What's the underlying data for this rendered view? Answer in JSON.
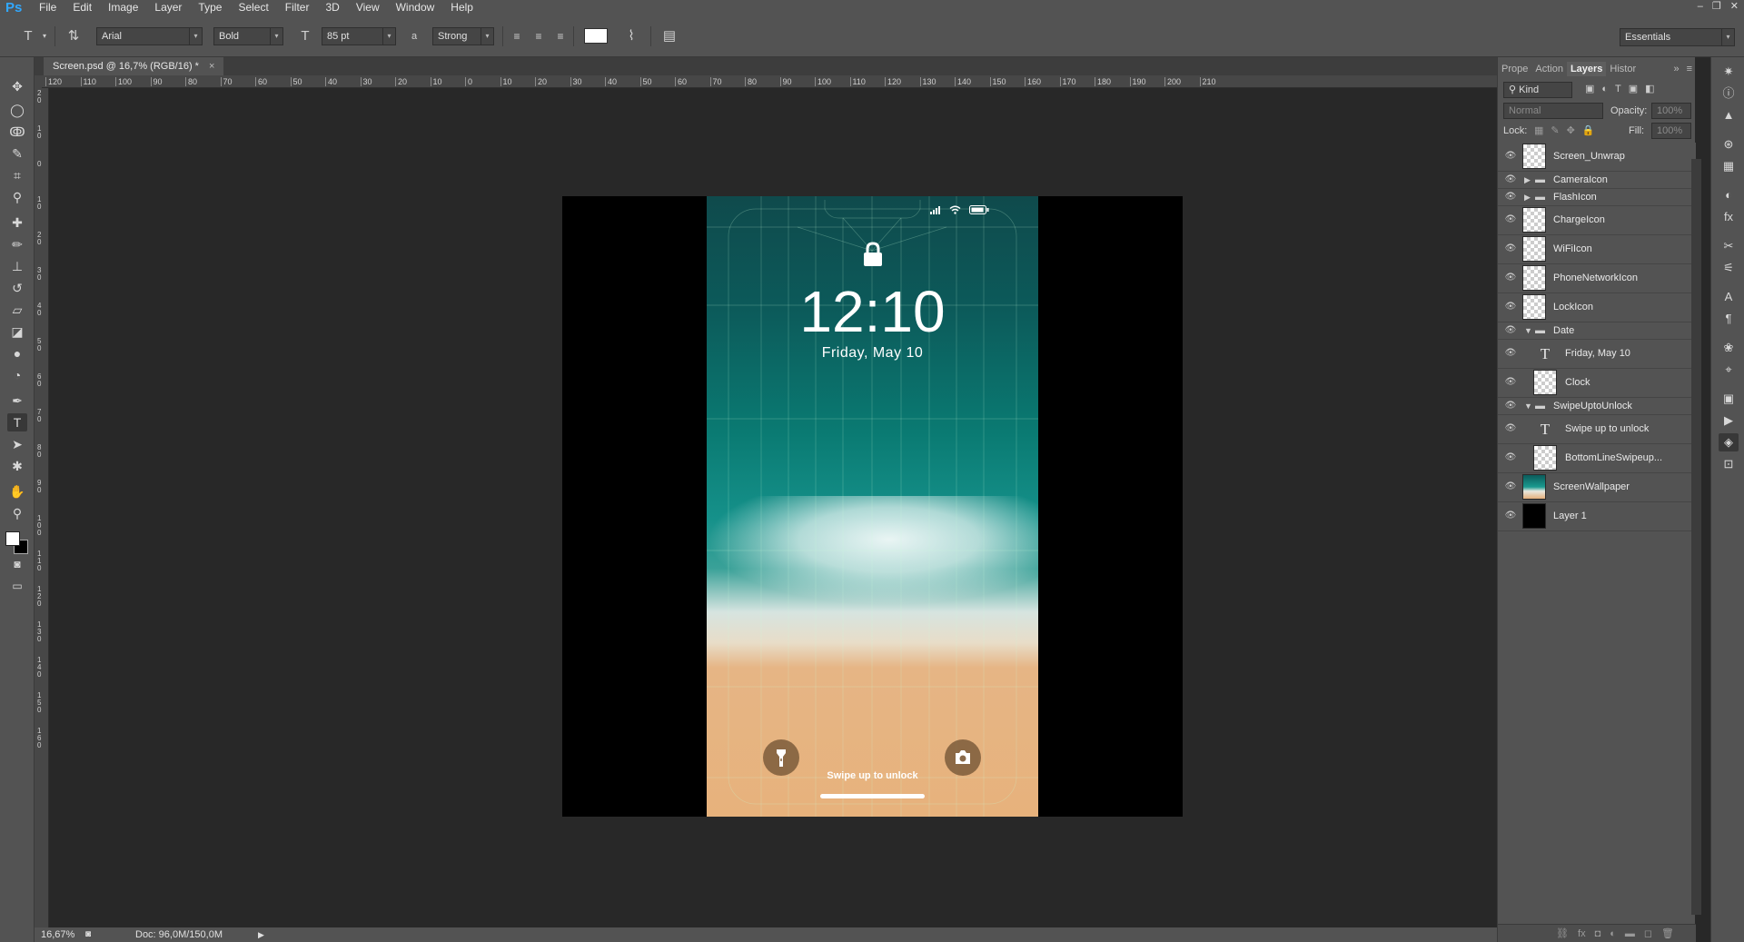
{
  "app": {
    "logo": "Ps"
  },
  "menu": [
    "File",
    "Edit",
    "Image",
    "Layer",
    "Type",
    "Select",
    "Filter",
    "3D",
    "View",
    "Window",
    "Help"
  ],
  "window_controls": [
    "–",
    "❐",
    "✕"
  ],
  "options_bar": {
    "font_family": "Arial",
    "font_style": "Bold",
    "font_size": "85 pt",
    "antialias": "Strong",
    "workspace": "Essentials",
    "aa_icon_text": "a"
  },
  "document": {
    "tab_title": "Screen.psd @ 16,7% (RGB/16) *",
    "tab_close": "×"
  },
  "rulers": {
    "h_labels": [
      "120",
      "110",
      "100",
      "90",
      "80",
      "70",
      "60",
      "50",
      "40",
      "30",
      "20",
      "10",
      "0",
      "10",
      "20",
      "30",
      "40",
      "50",
      "60",
      "70",
      "80",
      "90",
      "100",
      "110",
      "120",
      "130",
      "140",
      "150",
      "160",
      "170",
      "180",
      "190",
      "200",
      "210"
    ],
    "v_labels": [
      "2\n0",
      "1\n0",
      "0",
      "1\n0",
      "2\n0",
      "3\n0",
      "4\n0",
      "5\n0",
      "6\n0",
      "7\n0",
      "8\n0",
      "9\n0",
      "1\n0\n0",
      "1\n1\n0",
      "1\n2\n0",
      "1\n3\n0",
      "1\n4\n0",
      "1\n5\n0",
      "1\n6\n0"
    ]
  },
  "phone_screen": {
    "clock": "12:10",
    "date": "Friday, May 10",
    "swipe_text": "Swipe up to unlock"
  },
  "status_bar": {
    "zoom": "16,67%",
    "doc_info": "Doc: 96,0M/150,0M"
  },
  "panel": {
    "tabs": [
      "Prope",
      "Action",
      "Layers",
      "Histor"
    ],
    "active_tab": "Layers",
    "filter_kind": "Kind",
    "blend_mode": "Normal",
    "opacity_label": "Opacity:",
    "opacity_value": "100%",
    "lock_label": "Lock:",
    "fill_label": "Fill:",
    "fill_value": "100%",
    "layers": [
      {
        "name": "Screen_Unwrap",
        "kind": "pixel"
      },
      {
        "name": "CameraIcon",
        "kind": "group-collapsed"
      },
      {
        "name": "FlashIcon",
        "kind": "group-collapsed"
      },
      {
        "name": "ChargeIcon",
        "kind": "smart"
      },
      {
        "name": "WiFiIcon",
        "kind": "smart"
      },
      {
        "name": "PhoneNetworkIcon",
        "kind": "smart"
      },
      {
        "name": "LockIcon",
        "kind": "smart"
      },
      {
        "name": "Date",
        "kind": "group-open"
      },
      {
        "name": "Friday, May 10",
        "kind": "text"
      },
      {
        "name": "Clock",
        "kind": "pixel"
      },
      {
        "name": "SwipeUptoUnlock",
        "kind": "group-open"
      },
      {
        "name": "Swipe up to unlock",
        "kind": "text"
      },
      {
        "name": "BottomLineSwipeup...",
        "kind": "pixel"
      },
      {
        "name": "ScreenWallpaper",
        "kind": "wallpaper"
      },
      {
        "name": "Layer 1",
        "kind": "black"
      }
    ],
    "bottom_icons": [
      "link-icon",
      "fx-icon",
      "mask-icon",
      "adjustment-icon",
      "folder-icon",
      "new-layer-icon",
      "trash-icon"
    ],
    "bottom_glyphs": [
      "⛓",
      "fx",
      "◘",
      "◐",
      "▬",
      "◻",
      "🗑"
    ]
  },
  "colors": {
    "ui_bg": "#535353",
    "canvas_bg": "#282828",
    "accent": "#31a8ff"
  }
}
